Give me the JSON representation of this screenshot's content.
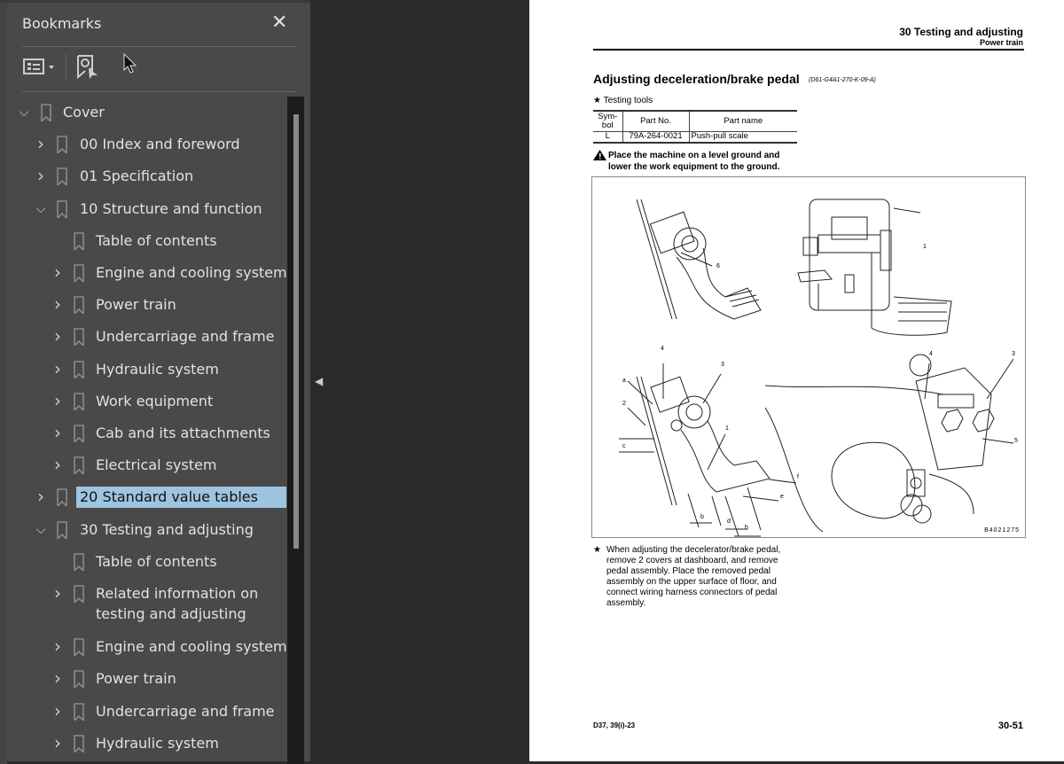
{
  "panel": {
    "title": "Bookmarks",
    "close_icon": "close-icon",
    "options_icon": "list-options-icon",
    "find_bookmark_icon": "find-current-bookmark-icon"
  },
  "bookmarks": [
    {
      "label": "Cover",
      "level": 0,
      "state": "expanded"
    },
    {
      "label": "00 Index and foreword",
      "level": 1,
      "state": "collapsed"
    },
    {
      "label": "01 Specification",
      "level": 1,
      "state": "collapsed"
    },
    {
      "label": "10 Structure and function",
      "level": 1,
      "state": "expanded"
    },
    {
      "label": "Table of contents",
      "level": 2,
      "state": "leaf"
    },
    {
      "label": "Engine and cooling system",
      "level": 2,
      "state": "collapsed"
    },
    {
      "label": "Power train",
      "level": 2,
      "state": "collapsed"
    },
    {
      "label": "Undercarriage and frame",
      "level": 2,
      "state": "collapsed"
    },
    {
      "label": "Hydraulic system",
      "level": 2,
      "state": "collapsed"
    },
    {
      "label": "Work equipment",
      "level": 2,
      "state": "collapsed"
    },
    {
      "label": "Cab and its attachments",
      "level": 2,
      "state": "collapsed"
    },
    {
      "label": "Electrical system",
      "level": 2,
      "state": "collapsed"
    },
    {
      "label": "20 Standard value tables",
      "level": 1,
      "state": "collapsed",
      "selected": true
    },
    {
      "label": "30 Testing and adjusting",
      "level": 1,
      "state": "expanded"
    },
    {
      "label": "Table of contents",
      "level": 2,
      "state": "leaf"
    },
    {
      "label": "Related information on",
      "label2": "testing and adjusting",
      "level": 2,
      "state": "collapsed"
    },
    {
      "label": "Engine and cooling system",
      "level": 2,
      "state": "collapsed"
    },
    {
      "label": "Power train",
      "level": 2,
      "state": "collapsed"
    },
    {
      "label": "Undercarriage and frame",
      "level": 2,
      "state": "collapsed"
    },
    {
      "label": "Hydraulic system",
      "level": 2,
      "state": "collapsed"
    }
  ],
  "colors": {
    "selected": "#9dc4e0",
    "panel": "#494949",
    "viewer_bg": "#2b2b2b"
  },
  "document": {
    "header_section": "30 Testing and adjusting",
    "header_sub": "Power train",
    "title": "Adjusting deceleration/brake pedal",
    "title_code": "(D61-G4A1-270-K-09-A)",
    "tools_label": "Testing tools",
    "tools_table": {
      "headers": [
        "Sym-\nbol",
        "Part No.",
        "Part name"
      ],
      "rows": [
        [
          "L",
          "79A-264-0021",
          "Push-pull scale"
        ]
      ]
    },
    "warning": "Place the machine on a level ground and lower the work equipment to the ground.",
    "figure_code": "B4021275",
    "figure_labels": [
      "6",
      "1",
      "4",
      "3",
      "a",
      "2",
      "1",
      "c",
      "f",
      "e",
      "b",
      "d",
      "h",
      "4",
      "3",
      "5"
    ],
    "note": "When adjusting the decelerator/brake pedal, remove 2 covers at dashboard, and remove pedal assembly. Place the removed pedal assembly on the upper surface of floor, and connect wiring harness connectors of pedal assembly.",
    "footer_model": "D37, 39(i)-23",
    "page_number": "30-51"
  }
}
